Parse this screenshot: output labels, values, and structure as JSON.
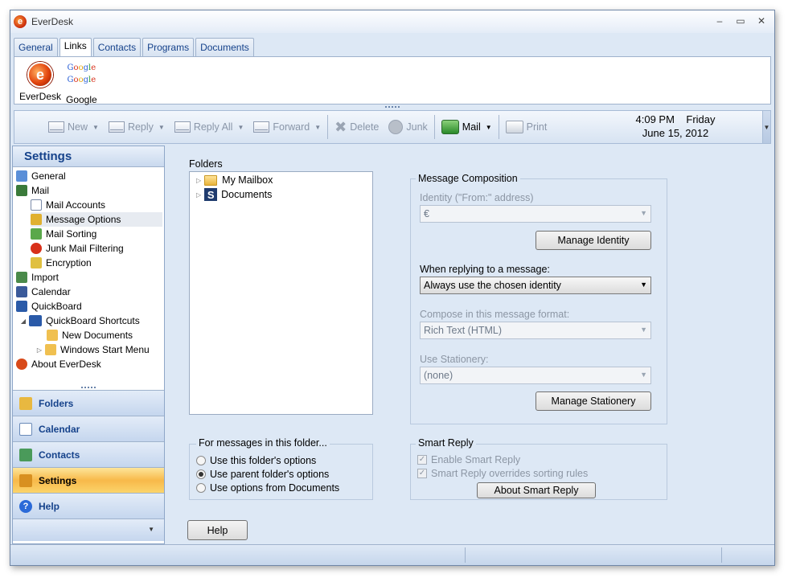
{
  "window": {
    "title": "EverDesk",
    "minimize": "–",
    "maximize": "▭",
    "close": "✕"
  },
  "top_tabs": [
    "General",
    "Links",
    "Contacts",
    "Programs",
    "Documents"
  ],
  "links": [
    {
      "label": "EverDesk",
      "icon": "everdesk-logo-icon"
    },
    {
      "label": "Google",
      "icon": "google-logo-icon",
      "logo_text": "Google"
    }
  ],
  "toolbar": {
    "new": "New",
    "reply": "Reply",
    "reply_all": "Reply All",
    "forward": "Forward",
    "delete": "Delete",
    "junk": "Junk",
    "mail": "Mail",
    "print": "Print",
    "dropdown": "▼"
  },
  "clock": {
    "time": "4:09 PM",
    "day": "Friday",
    "date": "June 15, 2012"
  },
  "sidebar": {
    "title": "Settings",
    "tree": [
      {
        "label": "General",
        "indent": 0,
        "color": "#5a8fd8"
      },
      {
        "label": "Mail",
        "indent": 0,
        "color": "#3a7a3a"
      },
      {
        "label": "Mail Accounts",
        "indent": 1,
        "color": "#7a8aa8"
      },
      {
        "label": "Message Options",
        "indent": 1,
        "color": "#e0b030",
        "selected": true
      },
      {
        "label": "Mail Sorting",
        "indent": 1,
        "color": "#5aa84a"
      },
      {
        "label": "Junk Mail Filtering",
        "indent": 1,
        "color": "#d8301a"
      },
      {
        "label": "Encryption",
        "indent": 1,
        "color": "#e0c040"
      },
      {
        "label": "Import",
        "indent": 0,
        "color": "#4a8a4a"
      },
      {
        "label": "Calendar",
        "indent": 0,
        "color": "#3a5a9a"
      },
      {
        "label": "QuickBoard",
        "indent": 0,
        "color": "#2a5aa8"
      },
      {
        "label": "QuickBoard Shortcuts",
        "indent": 1,
        "color": "#2a5aa8",
        "expander": "◢"
      },
      {
        "label": "New Documents",
        "indent": 2,
        "color": "#f0c050"
      },
      {
        "label": "Windows Start Menu",
        "indent": 2,
        "color": "#f0c050",
        "expander": "▷"
      },
      {
        "label": "About EverDesk",
        "indent": 0,
        "color": "#d84a1a"
      }
    ],
    "nav_buttons": [
      {
        "label": "Folders",
        "color": "#e8b840"
      },
      {
        "label": "Calendar",
        "color": "#6a8ab8"
      },
      {
        "label": "Contacts",
        "color": "#4a9a5a"
      },
      {
        "label": "Settings",
        "color": "#d89020",
        "active": true
      },
      {
        "label": "Help",
        "color": "#2a6ad8"
      }
    ],
    "nav_more": "▼"
  },
  "main": {
    "folders_label": "Folders",
    "folders": [
      {
        "label": "My Mailbox",
        "icon": "folder-icon"
      },
      {
        "label": "Documents",
        "icon": "documents-s-icon"
      }
    ],
    "folder_options": {
      "title": "For messages in this folder...",
      "options": [
        {
          "label": "Use this folder's options",
          "checked": false
        },
        {
          "label": "Use parent folder's options",
          "checked": true
        },
        {
          "label": "Use options from Documents",
          "checked": false
        }
      ]
    },
    "composition": {
      "title": "Message Composition",
      "identity_label": "Identity (\"From:\" address)",
      "identity_value": "€",
      "manage_identity": "Manage Identity",
      "reply_label": "When replying to a message:",
      "reply_value": "Always use the chosen identity",
      "format_label": "Compose in this message format:",
      "format_value": "Rich Text (HTML)",
      "stationery_label": "Use Stationery:",
      "stationery_value": "(none)",
      "manage_stationery": "Manage Stationery"
    },
    "smart_reply": {
      "title": "Smart Reply",
      "enable": "Enable Smart Reply",
      "overrides": "Smart Reply overrides sorting rules",
      "about": "About Smart Reply"
    },
    "help_button": "Help"
  }
}
